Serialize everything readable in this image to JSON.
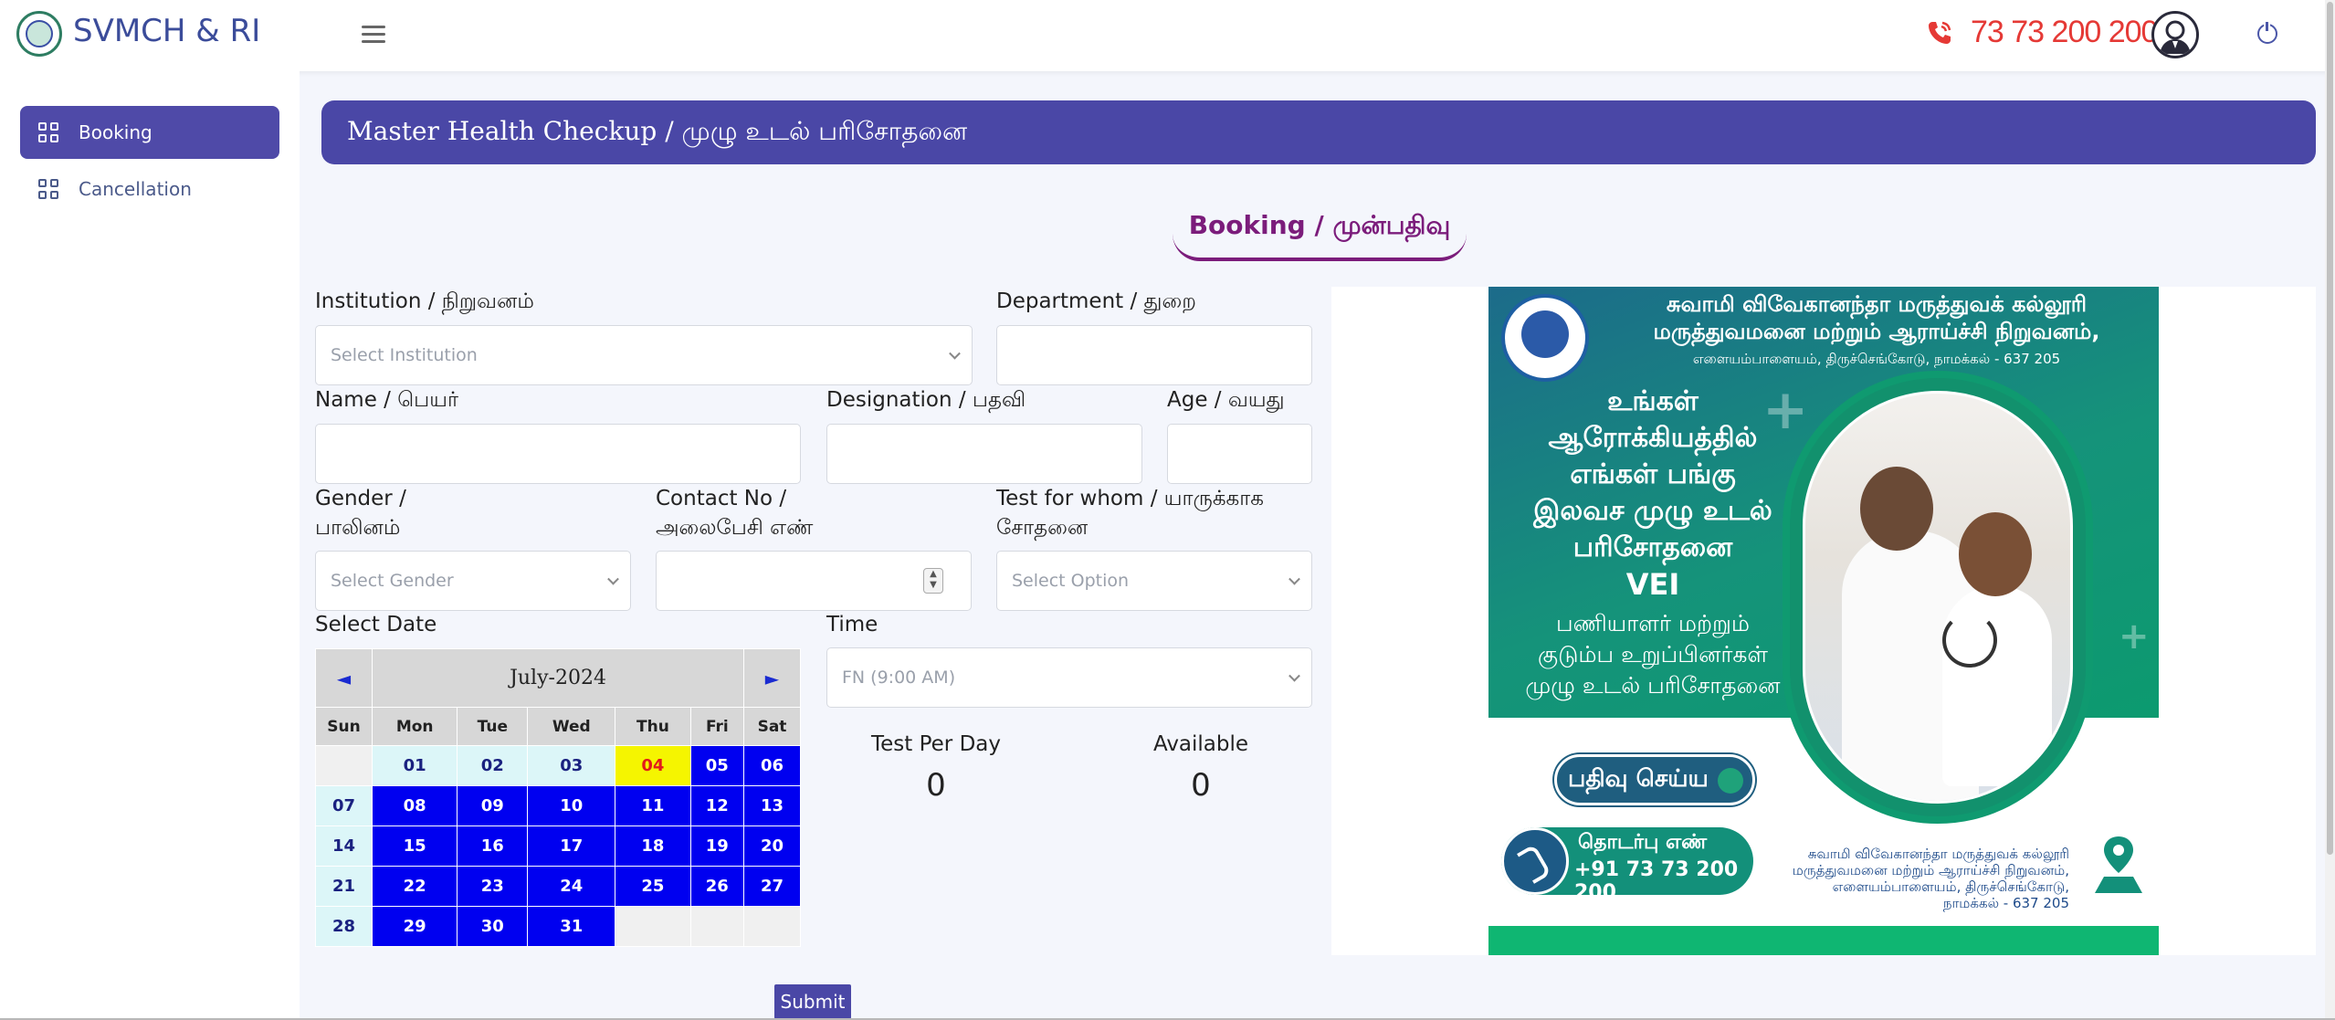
{
  "header": {
    "brand": "SVMCH & RI",
    "phone": "73 73 200 200",
    "colors": {
      "brand": "#3b4c9a",
      "phone": "#e53935"
    }
  },
  "sidebar": {
    "items": [
      {
        "label": "Booking",
        "icon": "grid-icon",
        "active": true
      },
      {
        "label": "Cancellation",
        "icon": "grid-icon",
        "active": false
      }
    ]
  },
  "main": {
    "title": "Master Health Checkup / முழு உடல் பரிசோதனை",
    "booking_heading": "Booking / முன்பதிவு",
    "form": {
      "institution": {
        "label": "Institution / நிறுவனம்",
        "placeholder": "Select Institution"
      },
      "department": {
        "label": "Department / துறை",
        "value": ""
      },
      "name": {
        "label": "Name / பெயர்",
        "value": ""
      },
      "designation": {
        "label": "Designation / பதவி",
        "value": ""
      },
      "age": {
        "label": "Age / வயது",
        "value": ""
      },
      "gender": {
        "label_line1": "Gender /",
        "label_line2": "பாலினம்",
        "placeholder": "Select Gender"
      },
      "contact": {
        "label_line1": "Contact No /",
        "label_line2": "அலைபேசி எண்",
        "value": ""
      },
      "test_for": {
        "label_line1": "Test for whom / யாருக்காக",
        "label_line2": "சோதனை",
        "placeholder": "Select Option"
      },
      "select_date": {
        "label": "Select Date"
      },
      "time": {
        "label": "Time",
        "selected": "FN (9:00 AM)"
      }
    },
    "calendar": {
      "month": "July-2024",
      "prev": "◄",
      "next": "►",
      "weekdays": [
        "Sun",
        "Mon",
        "Tue",
        "Wed",
        "Thu",
        "Fri",
        "Sat"
      ],
      "weeks": [
        [
          "",
          "01",
          "02",
          "03",
          "04",
          "05",
          "06"
        ],
        [
          "07",
          "08",
          "09",
          "10",
          "11",
          "12",
          "13"
        ],
        [
          "14",
          "15",
          "16",
          "17",
          "18",
          "19",
          "20"
        ],
        [
          "21",
          "22",
          "23",
          "24",
          "25",
          "26",
          "27"
        ],
        [
          "28",
          "29",
          "30",
          "31",
          "",
          "",
          ""
        ]
      ],
      "today": "04",
      "past_days": [
        "01",
        "02",
        "03",
        "07",
        "14",
        "21",
        "28"
      ],
      "colors": {
        "available": "#0000f0",
        "today": "#f5f500",
        "past": "#dcf6f8"
      }
    },
    "stats": {
      "test_per_day_label": "Test Per Day",
      "test_per_day": "0",
      "available_label": "Available",
      "available": "0"
    },
    "submit_label": "Submit"
  },
  "poster": {
    "inst_line1": "சுவாமி விவேகானந்தா மருத்துவக் கல்லூரி",
    "inst_line2": "மருத்துவமனை மற்றும் ஆராய்ச்சி நிறுவனம்,",
    "inst_line3": "எளையம்பாளையம், திருச்செங்கோடு, நாமக்கல் - 637 205",
    "head_line1": "உங்கள்",
    "head_line2": "ஆரோக்கியத்தில்",
    "head_line3": "எங்கள் பங்கு",
    "head_line4": "இலவச முழு உடல்",
    "head_line5": "பரிசோதனை",
    "head_line6": "VEI",
    "sub_line1": "பணியாளர் மற்றும்",
    "sub_line2": "குடும்ப உறுப்பினர்கள்",
    "sub_line3": "முழு உடல் பரிசோதனை",
    "book_btn": "பதிவு செய்ய",
    "contact_label": "தொடர்பு எண்",
    "contact_number": "+91 73 73 200 200",
    "addr_line1": "சுவாமி விவேகானந்தா மருத்துவக் கல்லூரி",
    "addr_line2": "மருத்துவமனை மற்றும் ஆராய்ச்சி நிறுவனம்,",
    "addr_line3": "எளையம்பாளையம், திருச்செங்கோடு,",
    "addr_line4": "நாமக்கல் - 637 205"
  }
}
